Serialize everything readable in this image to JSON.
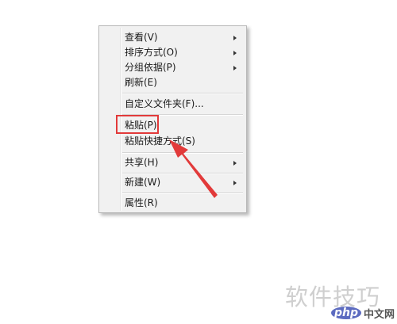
{
  "context_menu": {
    "items": [
      {
        "label": "查看(V)",
        "submenu": true
      },
      {
        "label": "排序方式(O)",
        "submenu": true
      },
      {
        "label": "分组依据(P)",
        "submenu": true
      },
      {
        "label": "刷新(E)",
        "submenu": false
      },
      {
        "label": "自定义文件夹(F)...",
        "submenu": false
      },
      {
        "label": "粘贴(P)",
        "submenu": false
      },
      {
        "label": "粘贴快捷方式(S)",
        "submenu": false
      },
      {
        "label": "共享(H)",
        "submenu": true
      },
      {
        "label": "新建(W)",
        "submenu": true
      },
      {
        "label": "属性(R)",
        "submenu": false
      }
    ]
  },
  "annotation": {
    "color": "#e23a3a"
  },
  "watermark": {
    "text": "软件技巧"
  },
  "logo": {
    "badge": "php",
    "text": "中文网"
  }
}
